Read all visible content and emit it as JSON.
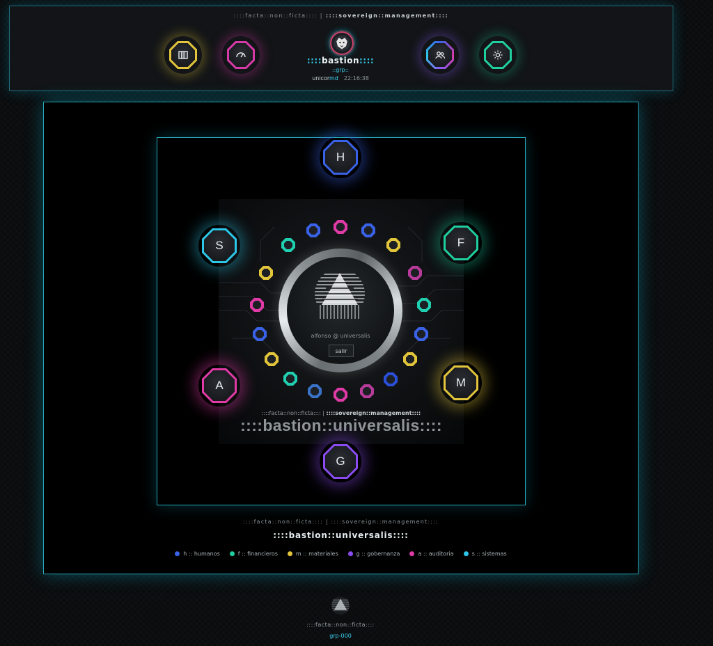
{
  "header": {
    "tagline_left": "::::facta::non::ficta::::",
    "tagline_sep": " | ",
    "tagline_right": "::::sovereign::management::::",
    "brand_prefix": "::::",
    "brand_name": "bastion",
    "brand_suffix": "::::",
    "group": "::grp::",
    "user_name": "unicor",
    "user_suffix": "md",
    "clock": "22:16:38",
    "icons": [
      {
        "name": "archive",
        "color": "#e2c53a"
      },
      {
        "name": "gauge",
        "color": "#d63aa7"
      },
      {
        "name": "users",
        "color": "#8a5cf0"
      },
      {
        "name": "settings",
        "color": "#1fcf9f"
      }
    ]
  },
  "modules": [
    {
      "letter": "H",
      "color": "#3a62e8"
    },
    {
      "letter": "F",
      "color": "#1fcf9f"
    },
    {
      "letter": "M",
      "color": "#e2c53a"
    },
    {
      "letter": "G",
      "color": "#8a4cf0"
    },
    {
      "letter": "A",
      "color": "#e03aa7"
    },
    {
      "letter": "S",
      "color": "#2cc7e8"
    }
  ],
  "ring_dots": [
    {
      "color": "#e03aa7"
    },
    {
      "color": "#3a62e8"
    },
    {
      "color": "#e2c53a"
    },
    {
      "color": "#b83a9a"
    },
    {
      "color": "#1fcfb0"
    },
    {
      "color": "#3a62e8"
    },
    {
      "color": "#e2c53a"
    },
    {
      "color": "#2a4fd8"
    },
    {
      "color": "#b83a9a"
    },
    {
      "color": "#e03aa7"
    },
    {
      "color": "#3a72c8"
    },
    {
      "color": "#1fcfb0"
    },
    {
      "color": "#e2c53a"
    },
    {
      "color": "#3a62e8"
    },
    {
      "color": "#e03aa7"
    },
    {
      "color": "#e2c53a"
    },
    {
      "color": "#1fcfb0"
    },
    {
      "color": "#3a62e8"
    }
  ],
  "center": {
    "user": "alfonso @ universalis",
    "logout": "salir"
  },
  "scene": {
    "tagline_left": "::::facta::non::ficta::::",
    "tagline_sep": " | ",
    "tagline_right": "::::sovereign::management::::",
    "title": "::::bastion::universalis::::"
  },
  "footer": {
    "tagline": "::::facta::non::ficta:::: | ::::sovereign::management::::",
    "title": "::::bastion::universalis::::",
    "legend": [
      {
        "label": "h :: humanos",
        "color": "#3a62e8"
      },
      {
        "label": "f :: financieros",
        "color": "#1fcf9f"
      },
      {
        "label": "m :: materiales",
        "color": "#e2c53a"
      },
      {
        "label": "g :: gobernanza",
        "color": "#8a4cf0"
      },
      {
        "label": "a :: auditoria",
        "color": "#e03aa7"
      },
      {
        "label": "s :: sistemas",
        "color": "#2cc7e8"
      }
    ]
  },
  "bottom": {
    "tagline": "::::facta::non::ficta::::",
    "group": "grp-000"
  }
}
